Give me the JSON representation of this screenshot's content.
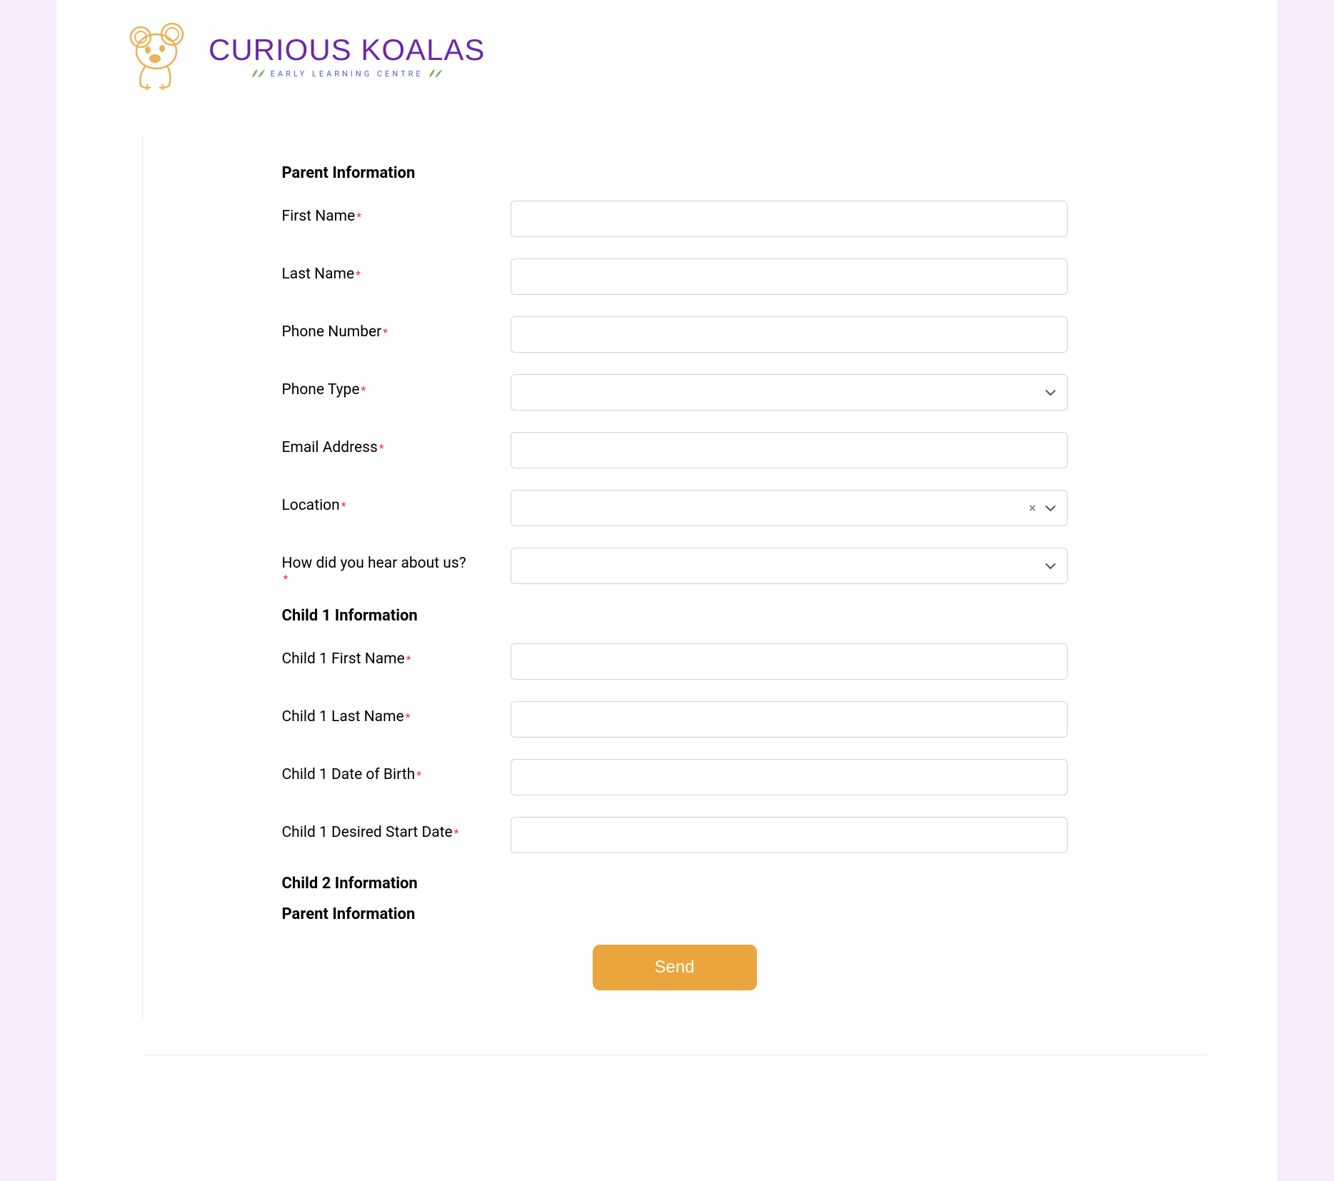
{
  "brand": {
    "name": "CURIOUS KOALAS",
    "tagline": "EARLY LEARNING CENTRE"
  },
  "form": {
    "sections": {
      "parent_info_heading": "Parent Information",
      "child1_info_heading": "Child 1 Information",
      "child2_info_heading": "Child 2 Information",
      "parent_info_heading2": "Parent Information"
    },
    "labels": {
      "first_name": "First Name",
      "last_name": "Last Name",
      "phone_number": "Phone Number",
      "phone_type": "Phone Type",
      "email_address": "Email Address",
      "location": "Location",
      "how_heard": "How did you hear about us?",
      "child1_first_name": "Child 1 First Name",
      "child1_last_name": "Child 1 Last Name",
      "child1_dob": "Child 1 Date of Birth",
      "child1_start_date": "Child 1 Desired Start Date"
    },
    "required_marker": "*",
    "submit_label": "Send"
  }
}
